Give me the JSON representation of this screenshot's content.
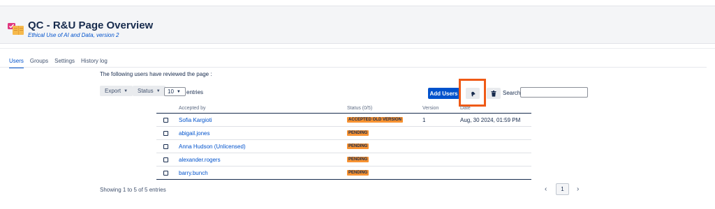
{
  "header": {
    "title": "QC - R&U Page Overview",
    "subtitle": "Ethical Use of AI and Data, version 2",
    "icon": "page-overview-app-icon"
  },
  "tabs": [
    {
      "label": "Users",
      "active": true
    },
    {
      "label": "Groups",
      "active": false
    },
    {
      "label": "Settings",
      "active": false
    },
    {
      "label": "History log",
      "active": false
    }
  ],
  "intro_text": "The following users have reviewed the page :",
  "toolbar": {
    "export_label": "Export",
    "status_label": "Status",
    "entries_value": "10",
    "entries_label": "entries",
    "add_users_label": "Add Users",
    "notify_icon": "bell-icon",
    "delete_icon": "trash-icon",
    "search_label": "Search",
    "search_value": ""
  },
  "table": {
    "headers": {
      "accepted_by": "Accepted by",
      "status": "Status (0/5)",
      "version": "Version",
      "date": "Date"
    },
    "rows": [
      {
        "name": "Sofia Kargioti",
        "status": "ACCEPTED OLD VERSION",
        "version": "1",
        "date": "Aug, 30 2024, 01:59 PM"
      },
      {
        "name": "abigail.jones",
        "status": "PENDING",
        "version": "",
        "date": ""
      },
      {
        "name": "Anna Hudson (Unlicensed)",
        "status": "PENDING",
        "version": "",
        "date": ""
      },
      {
        "name": "alexander.rogers",
        "status": "PENDING",
        "version": "",
        "date": ""
      },
      {
        "name": "barry.bunch",
        "status": "PENDING",
        "version": "",
        "date": ""
      }
    ]
  },
  "footer": {
    "info": "Showing 1 to 5 of 5 entries",
    "prev": "‹",
    "page": "1",
    "next": "›"
  },
  "colors": {
    "accent": "#0052cc",
    "status_badge": "#f79232",
    "highlight": "#ef5a16"
  }
}
